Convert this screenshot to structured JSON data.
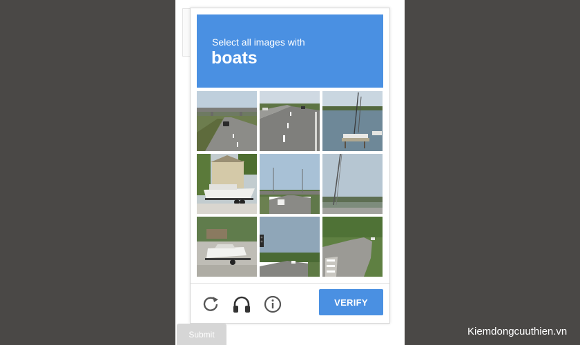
{
  "challenge": {
    "instruction": "Select all images with",
    "target": "boats"
  },
  "tiles": [
    {
      "id": 1,
      "scene": "highway-overpass-car"
    },
    {
      "id": 2,
      "scene": "highway-lanes"
    },
    {
      "id": 3,
      "scene": "harbor-sailboat"
    },
    {
      "id": 4,
      "scene": "boat-on-trailer-house"
    },
    {
      "id": 5,
      "scene": "highway-overpass-streetlights"
    },
    {
      "id": 6,
      "scene": "radio-tower-sky"
    },
    {
      "id": 7,
      "scene": "boat-on-trailer-trees"
    },
    {
      "id": 8,
      "scene": "road-traffic-light"
    },
    {
      "id": 9,
      "scene": "curved-road-crosswalk"
    }
  ],
  "controls": {
    "reload_icon": "reload-icon",
    "audio_icon": "headphones-icon",
    "info_icon": "info-icon",
    "verify_label": "VERIFY"
  },
  "form": {
    "submit_label": "Submit"
  },
  "watermark": "Kiemdongcuuthien.vn",
  "colors": {
    "accent": "#4a90e2",
    "backdrop": "#4a4846"
  }
}
